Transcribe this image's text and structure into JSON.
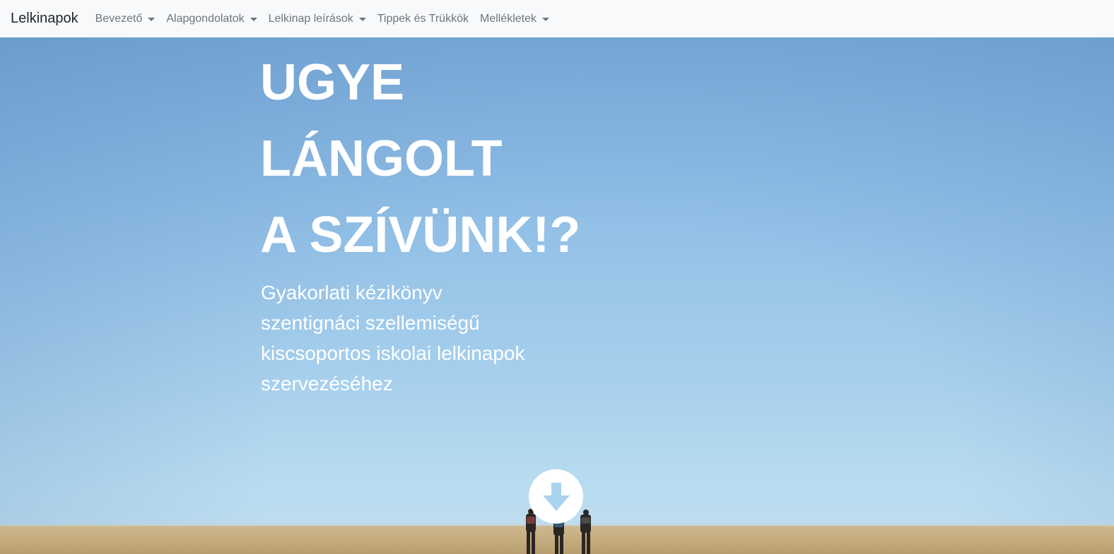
{
  "navbar": {
    "brand": "Lelkinapok",
    "items": [
      {
        "label": "Bevezető",
        "dropdown": true
      },
      {
        "label": "Alapgondolatok",
        "dropdown": true
      },
      {
        "label": "Lelkinap leírások",
        "dropdown": true
      },
      {
        "label": "Tippek és Trükkök",
        "dropdown": false
      },
      {
        "label": "Mellékletek",
        "dropdown": true
      }
    ]
  },
  "hero": {
    "title_lines": [
      "UGYE",
      "LÁNGOLT",
      "A SZÍVÜNK!?"
    ],
    "subtitle_lines": [
      "Gyakorlati kézikönyv",
      "szentignáci szellemiségű",
      "kiscsoportos iskolai lelkinapok",
      "szervezéséhez"
    ],
    "scroll_icon": "arrow-down-icon"
  },
  "colors": {
    "navbar_bg": "#f8f9fa",
    "brand_text": "#212529",
    "nav_text": "#6c757d",
    "sky_top": "#7eaedb",
    "sky_bottom": "#c2def0",
    "hero_text": "#ffffff",
    "arrow": "#a9d3ef",
    "ground": "#c6ad80"
  }
}
